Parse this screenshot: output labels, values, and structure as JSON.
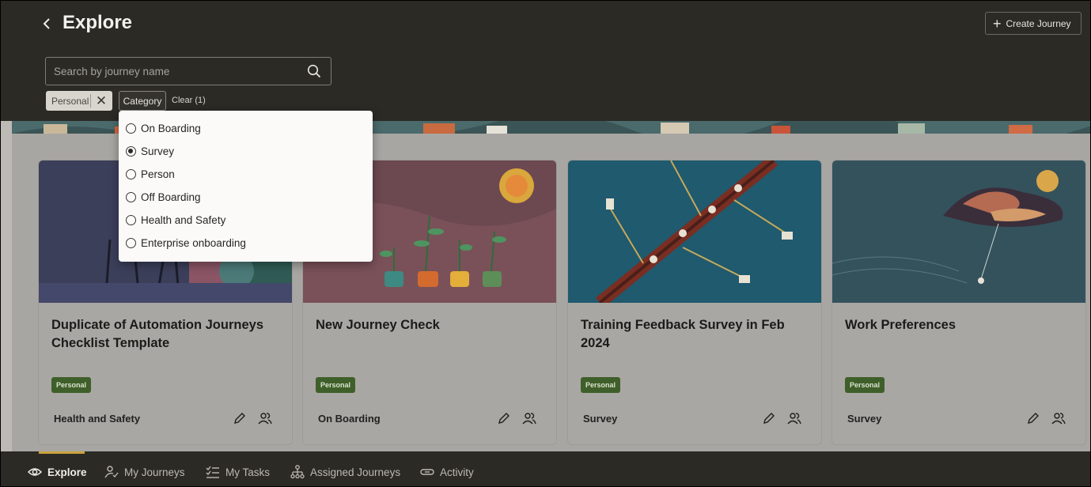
{
  "header": {
    "title": "Explore",
    "create_label": "Create Journey",
    "search_placeholder": "Search by journey name"
  },
  "filters": {
    "active_chip": "Personal",
    "category_label": "Category",
    "clear_label": "Clear (1)"
  },
  "category_menu": {
    "selected": "Survey",
    "options": [
      "On Boarding",
      "Survey",
      "Person",
      "Off Boarding",
      "Health and Safety",
      "Enterprise onboarding"
    ]
  },
  "cards": [
    {
      "title": "Duplicate of Automation Journeys Checklist Template",
      "badge": "Personal",
      "category": "Health and Safety"
    },
    {
      "title": "New Journey Check",
      "badge": "Personal",
      "category": "On Boarding"
    },
    {
      "title": "Training Feedback Survey in Feb 2024",
      "badge": "Personal",
      "category": "Survey"
    },
    {
      "title": "Work Preferences",
      "badge": "Personal",
      "category": "Survey"
    }
  ],
  "bottom_nav": [
    {
      "label": "Explore",
      "icon": "eye-icon",
      "active": true
    },
    {
      "label": "My Journeys",
      "icon": "person-check-icon",
      "active": false
    },
    {
      "label": "My Tasks",
      "icon": "checklist-icon",
      "active": false
    },
    {
      "label": "Assigned Journeys",
      "icon": "org-chart-icon",
      "active": false
    },
    {
      "label": "Activity",
      "icon": "link-icon",
      "active": false
    }
  ],
  "colors": {
    "header_bg": "#2b2a25",
    "badge_bg": "#3f5f2a",
    "active_tab_accent": "#c9a23f"
  }
}
